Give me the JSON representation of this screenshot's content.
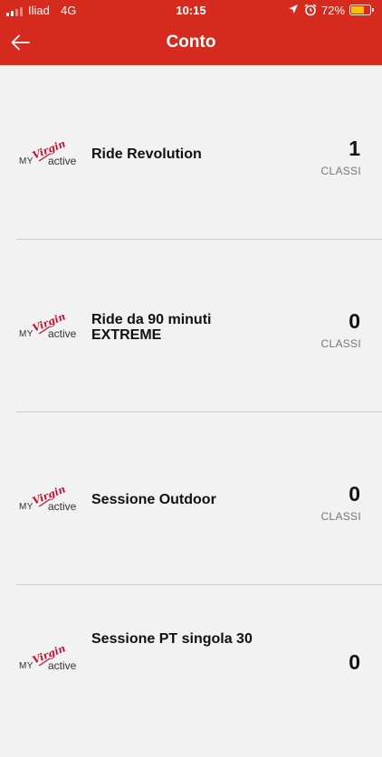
{
  "status_bar": {
    "carrier": "Iliad",
    "network": "4G",
    "time": "10:15",
    "battery_percent": "72%",
    "battery_level": 0.72,
    "icons": [
      "location-arrow-icon",
      "alarm-icon"
    ]
  },
  "header": {
    "title": "Conto",
    "back_icon": "arrow-left-icon",
    "background": "#d52b1e"
  },
  "logo": {
    "my": "MY",
    "virgin": "Virgin",
    "active": "active"
  },
  "items": [
    {
      "name": "Ride Revolution",
      "count": "1",
      "unit": "CLASSI"
    },
    {
      "name": "Ride da 90 minuti EXTREME",
      "count": "0",
      "unit": "CLASSI"
    },
    {
      "name": "Sessione Outdoor",
      "count": "0",
      "unit": "CLASSI"
    },
    {
      "name": "Sessione PT singola 30",
      "count": "0",
      "unit": ""
    }
  ]
}
